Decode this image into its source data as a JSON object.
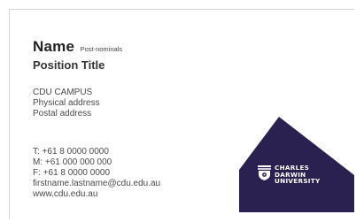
{
  "card": {
    "name": "Name",
    "postnominals": "Post-nominals",
    "position_title": "Position Title",
    "address_lines": [
      "CDU CAMPUS",
      "Physical address",
      "Postal address"
    ],
    "contact_lines": [
      "T:  +61 8 0000 0000",
      "M: +61 000 000 000",
      "F:  +61 8 0000 0000",
      "firstname.lastname@cdu.edu.au",
      "www.cdu.edu.au"
    ]
  },
  "logo": {
    "icon": "university-crest-icon",
    "text_lines": [
      "CHARLES",
      "DARWIN",
      "UNIVERSITY"
    ],
    "panel_color": "#2b2150"
  }
}
